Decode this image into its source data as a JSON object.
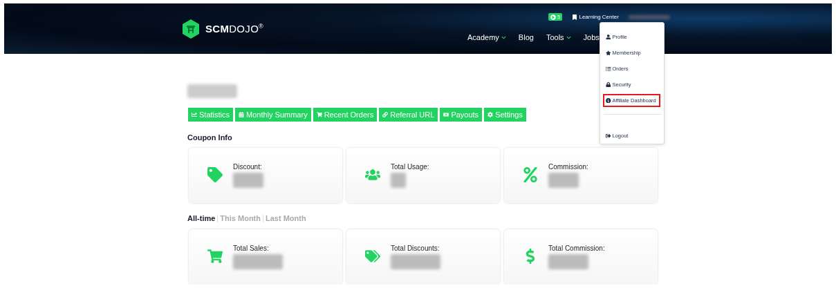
{
  "header": {
    "logo": "**SCM**DOJO$^{®}$",
    "badge": "5",
    "top_link": "Learning Center",
    "nav": [
      {
        "label": "Academy",
        "dropdown": true
      },
      {
        "label": "Blog",
        "dropdown": false
      },
      {
        "label": "Tools",
        "dropdown": true
      },
      {
        "label": "Jobs",
        "dropdown": false
      }
    ]
  },
  "account_menu": {
    "items": [
      {
        "label": "Profile",
        "selected": false
      },
      {
        "label": "Membership",
        "selected": false
      },
      {
        "label": "Orders",
        "selected": false
      },
      {
        "label": "Security",
        "selected": false
      },
      {
        "label": "Affiliate Dashboard",
        "selected": true
      }
    ],
    "logout": "Logout"
  },
  "tabs": [
    {
      "label": "Statistics"
    },
    {
      "label": "Monthly Summary"
    },
    {
      "label": "Recent Orders"
    },
    {
      "label": "Referral URL"
    },
    {
      "label": "Payouts"
    },
    {
      "label": "Settings"
    }
  ],
  "coupon_info": {
    "title": "Coupon Info",
    "cards": [
      {
        "label": "Discount:"
      },
      {
        "label": "Total Usage:"
      },
      {
        "label": "Commission:"
      }
    ]
  },
  "periods": [
    {
      "label": "All-time",
      "selected": true
    },
    {
      "label": "This Month",
      "selected": false
    },
    {
      "label": "Last Month",
      "selected": false
    }
  ],
  "totals": [
    {
      "label": "Total Sales:"
    },
    {
      "label": "Total Discounts:"
    },
    {
      "label": "Total Commission:"
    }
  ]
}
